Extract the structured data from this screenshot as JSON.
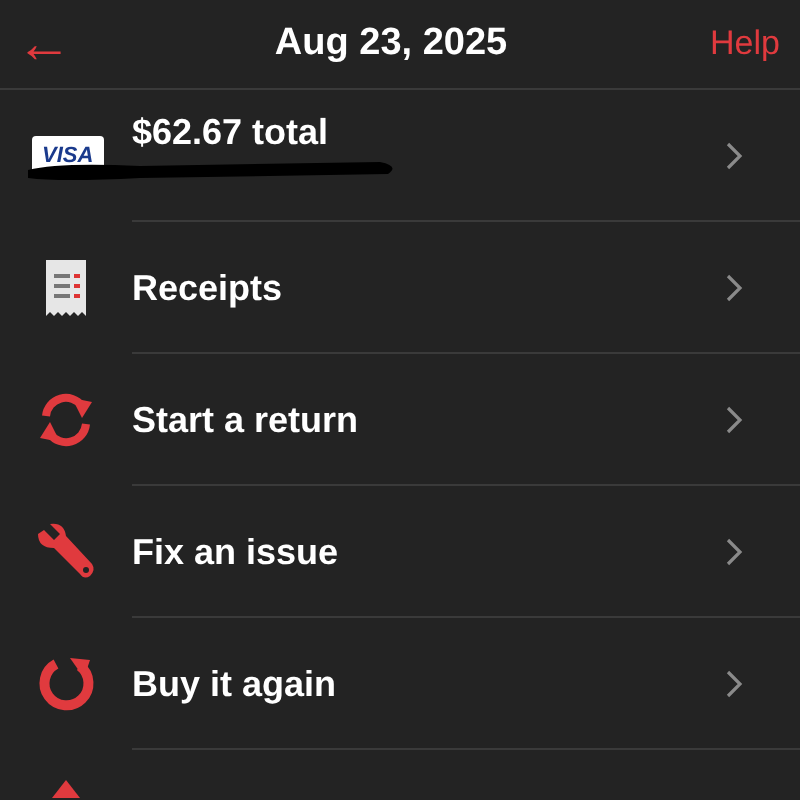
{
  "header": {
    "back_icon": "←",
    "title": "Aug 23, 2025",
    "action": "Help"
  },
  "payment": {
    "card_brand": "VISA",
    "total": "$62.67 total",
    "redacted": true
  },
  "items": [
    {
      "kind": "receipt",
      "label": "Receipts"
    },
    {
      "kind": "return",
      "label": "Start a return"
    },
    {
      "kind": "fix",
      "label": "Fix an issue"
    },
    {
      "kind": "rebuy",
      "label": "Buy it again"
    },
    {
      "kind": "warning"
    }
  ]
}
